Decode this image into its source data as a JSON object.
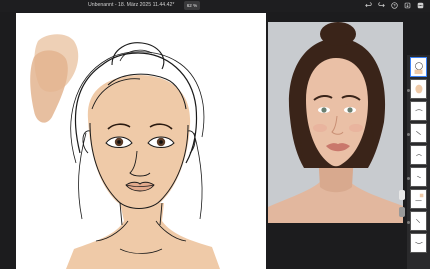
{
  "app": {
    "document_title": "Unbenannt - 18. März 2025 11.44.42*",
    "zoom": "62 %"
  },
  "toolbar": {
    "icons": [
      "undo-icon",
      "redo-icon",
      "help-icon",
      "export-icon",
      "more-icon"
    ]
  },
  "colors": {
    "background": "#1c1c1e",
    "canvas": "#ffffff",
    "skin": "#efcaa8",
    "swatch_dark": "#e0b08a",
    "swatch_light": "#efcfb3",
    "line": "#1a1a1a"
  },
  "layers": {
    "count": 9,
    "selected_index": 0
  }
}
